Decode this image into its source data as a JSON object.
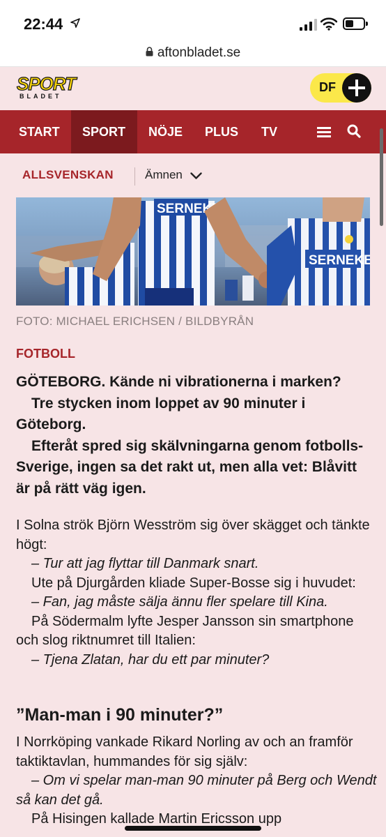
{
  "status_bar": {
    "time": "22:44"
  },
  "browser": {
    "url": "aftonbladet.se"
  },
  "header": {
    "logo_top": "SPORT",
    "logo_bottom": "BLADET",
    "df_label": "DF"
  },
  "nav": {
    "items": [
      {
        "label": "START"
      },
      {
        "label": "SPORT"
      },
      {
        "label": "NÖJE"
      },
      {
        "label": "PLUS"
      },
      {
        "label": "TV"
      }
    ],
    "active": "SPORT"
  },
  "subnav": {
    "section": "ALLSVENSKAN",
    "topics_label": "Ämnen"
  },
  "hero": {
    "shirt_sponsor": "SERNEKE",
    "caption": "FOTO: MICHAEL ERICHSEN / BILDBYRÅN"
  },
  "article": {
    "kicker": "FOTBOLL",
    "lead": [
      "GÖTEBORG. Kände ni vibrationerna i marken?",
      "Tre stycken inom loppet av 90 minuter i Göteborg.",
      "Efteråt spred sig skälvningarna genom fotbolls-Sverige, ingen sa det rakt ut, men alla vet: Blåvitt är på rätt väg igen."
    ],
    "body": [
      "I Solna strök Björn Wesström sig över skägget och tänkte högt:",
      "– Tur att jag flyttar till Danmark snart.",
      "Ute på Djurgården kliade Super-Bosse sig i huvudet:",
      "– Fan, jag måste sälja ännu fler spelare till Kina.",
      "På Södermalm lyfte Jesper Jansson sin smartphone och slog riktnumret till Italien:",
      "– Tjena Zlatan, har du ett par minuter?"
    ],
    "subheading": "”Man-man i 90 minuter?”",
    "body2": [
      "I Norrköping vankade Rikard Norling av och an framför taktiktavlan, hummandes för sig själv:",
      "– Om vi spelar man-man 90 minuter på Berg och Wendt så kan det gå.",
      "På Hisingen kallade Martin Ericsson upp"
    ]
  },
  "colors": {
    "accent": "#a6252a",
    "page_bg": "#f7e4e6",
    "logo_yellow": "#f7d40c",
    "df_yellow": "#fbe84a"
  }
}
